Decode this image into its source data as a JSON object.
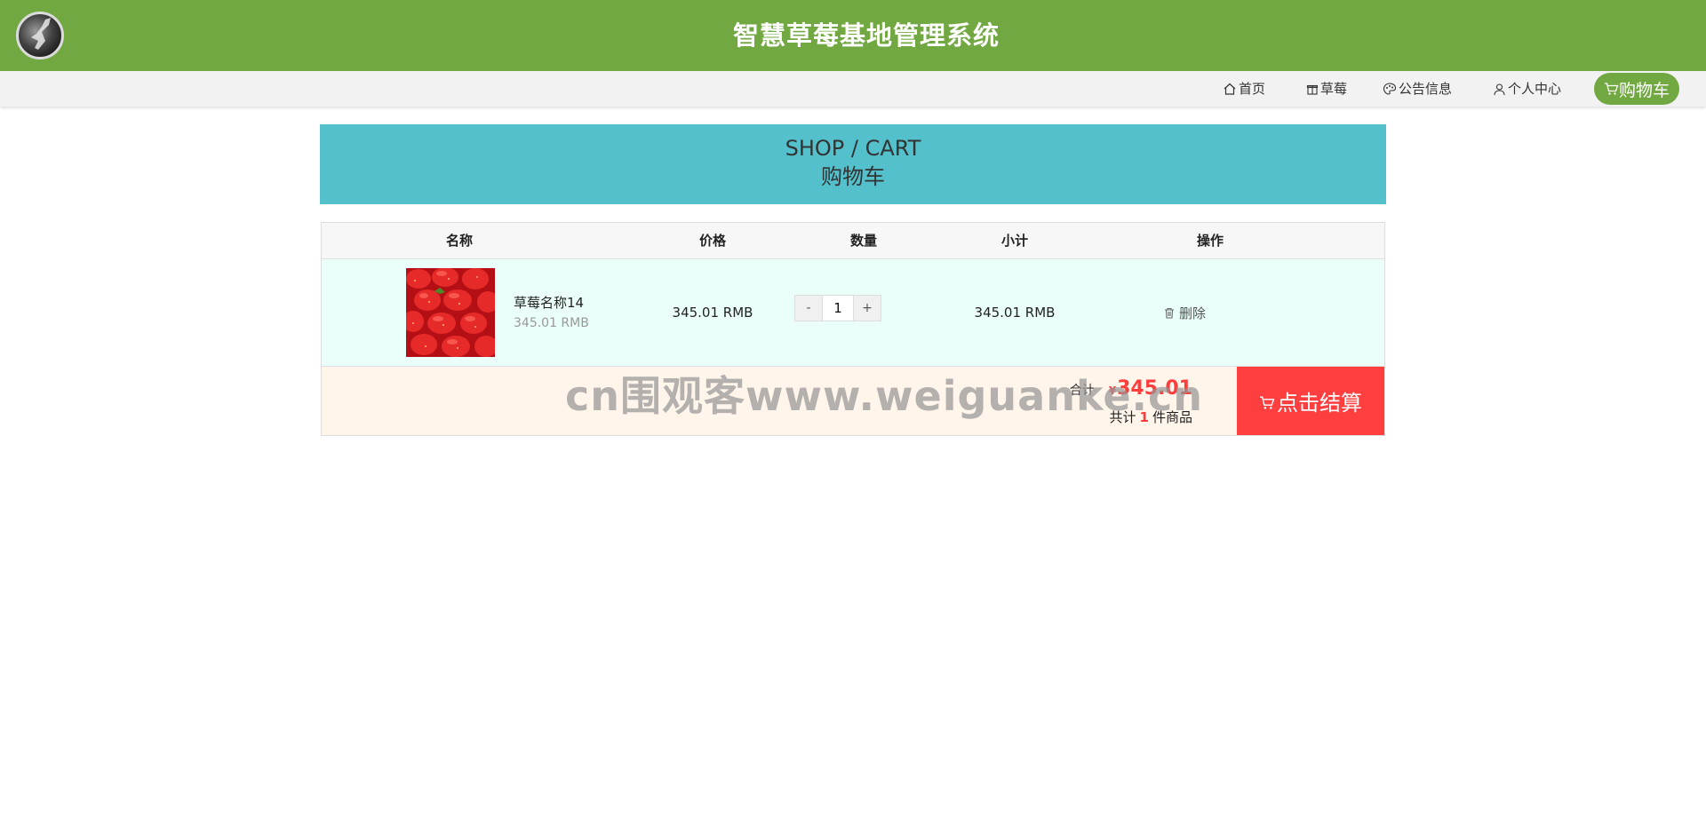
{
  "header": {
    "title": "智慧草莓基地管理系统"
  },
  "nav": {
    "items": [
      {
        "label": "首页",
        "icon": "home-icon"
      },
      {
        "label": "草莓",
        "icon": "gift-icon"
      },
      {
        "label": "公告信息",
        "icon": "palette-icon"
      },
      {
        "label": "个人中心",
        "icon": "user-icon"
      }
    ],
    "cart": {
      "label": "购物车",
      "icon": "cart-icon"
    }
  },
  "banner": {
    "en": "SHOP / CART",
    "cn": "购物车"
  },
  "table": {
    "headers": [
      "名称",
      "价格",
      "数量",
      "小计",
      "操作"
    ],
    "rows": [
      {
        "name": "草莓名称14",
        "unit_price": "345.01 RMB",
        "price": "345.01 RMB",
        "quantity": "1",
        "decrement": "-",
        "increment": "+",
        "subtotal": "345.01 RMB",
        "action": "删除"
      }
    ]
  },
  "summary": {
    "total_label": "合计",
    "currency": "¥",
    "total_amount": "345.01",
    "count_prefix": "共计",
    "count": "1",
    "count_suffix": "件商品",
    "checkout_label": "点击结算"
  },
  "watermark": {
    "text": "cn围观客www.weiguanke.cn"
  },
  "colors": {
    "header_bg": "#72a841",
    "banner_bg": "#53c0cc",
    "row_bg": "#eafff9",
    "footer_bg": "#fff5ea",
    "accent_red": "#ff3f3f"
  }
}
